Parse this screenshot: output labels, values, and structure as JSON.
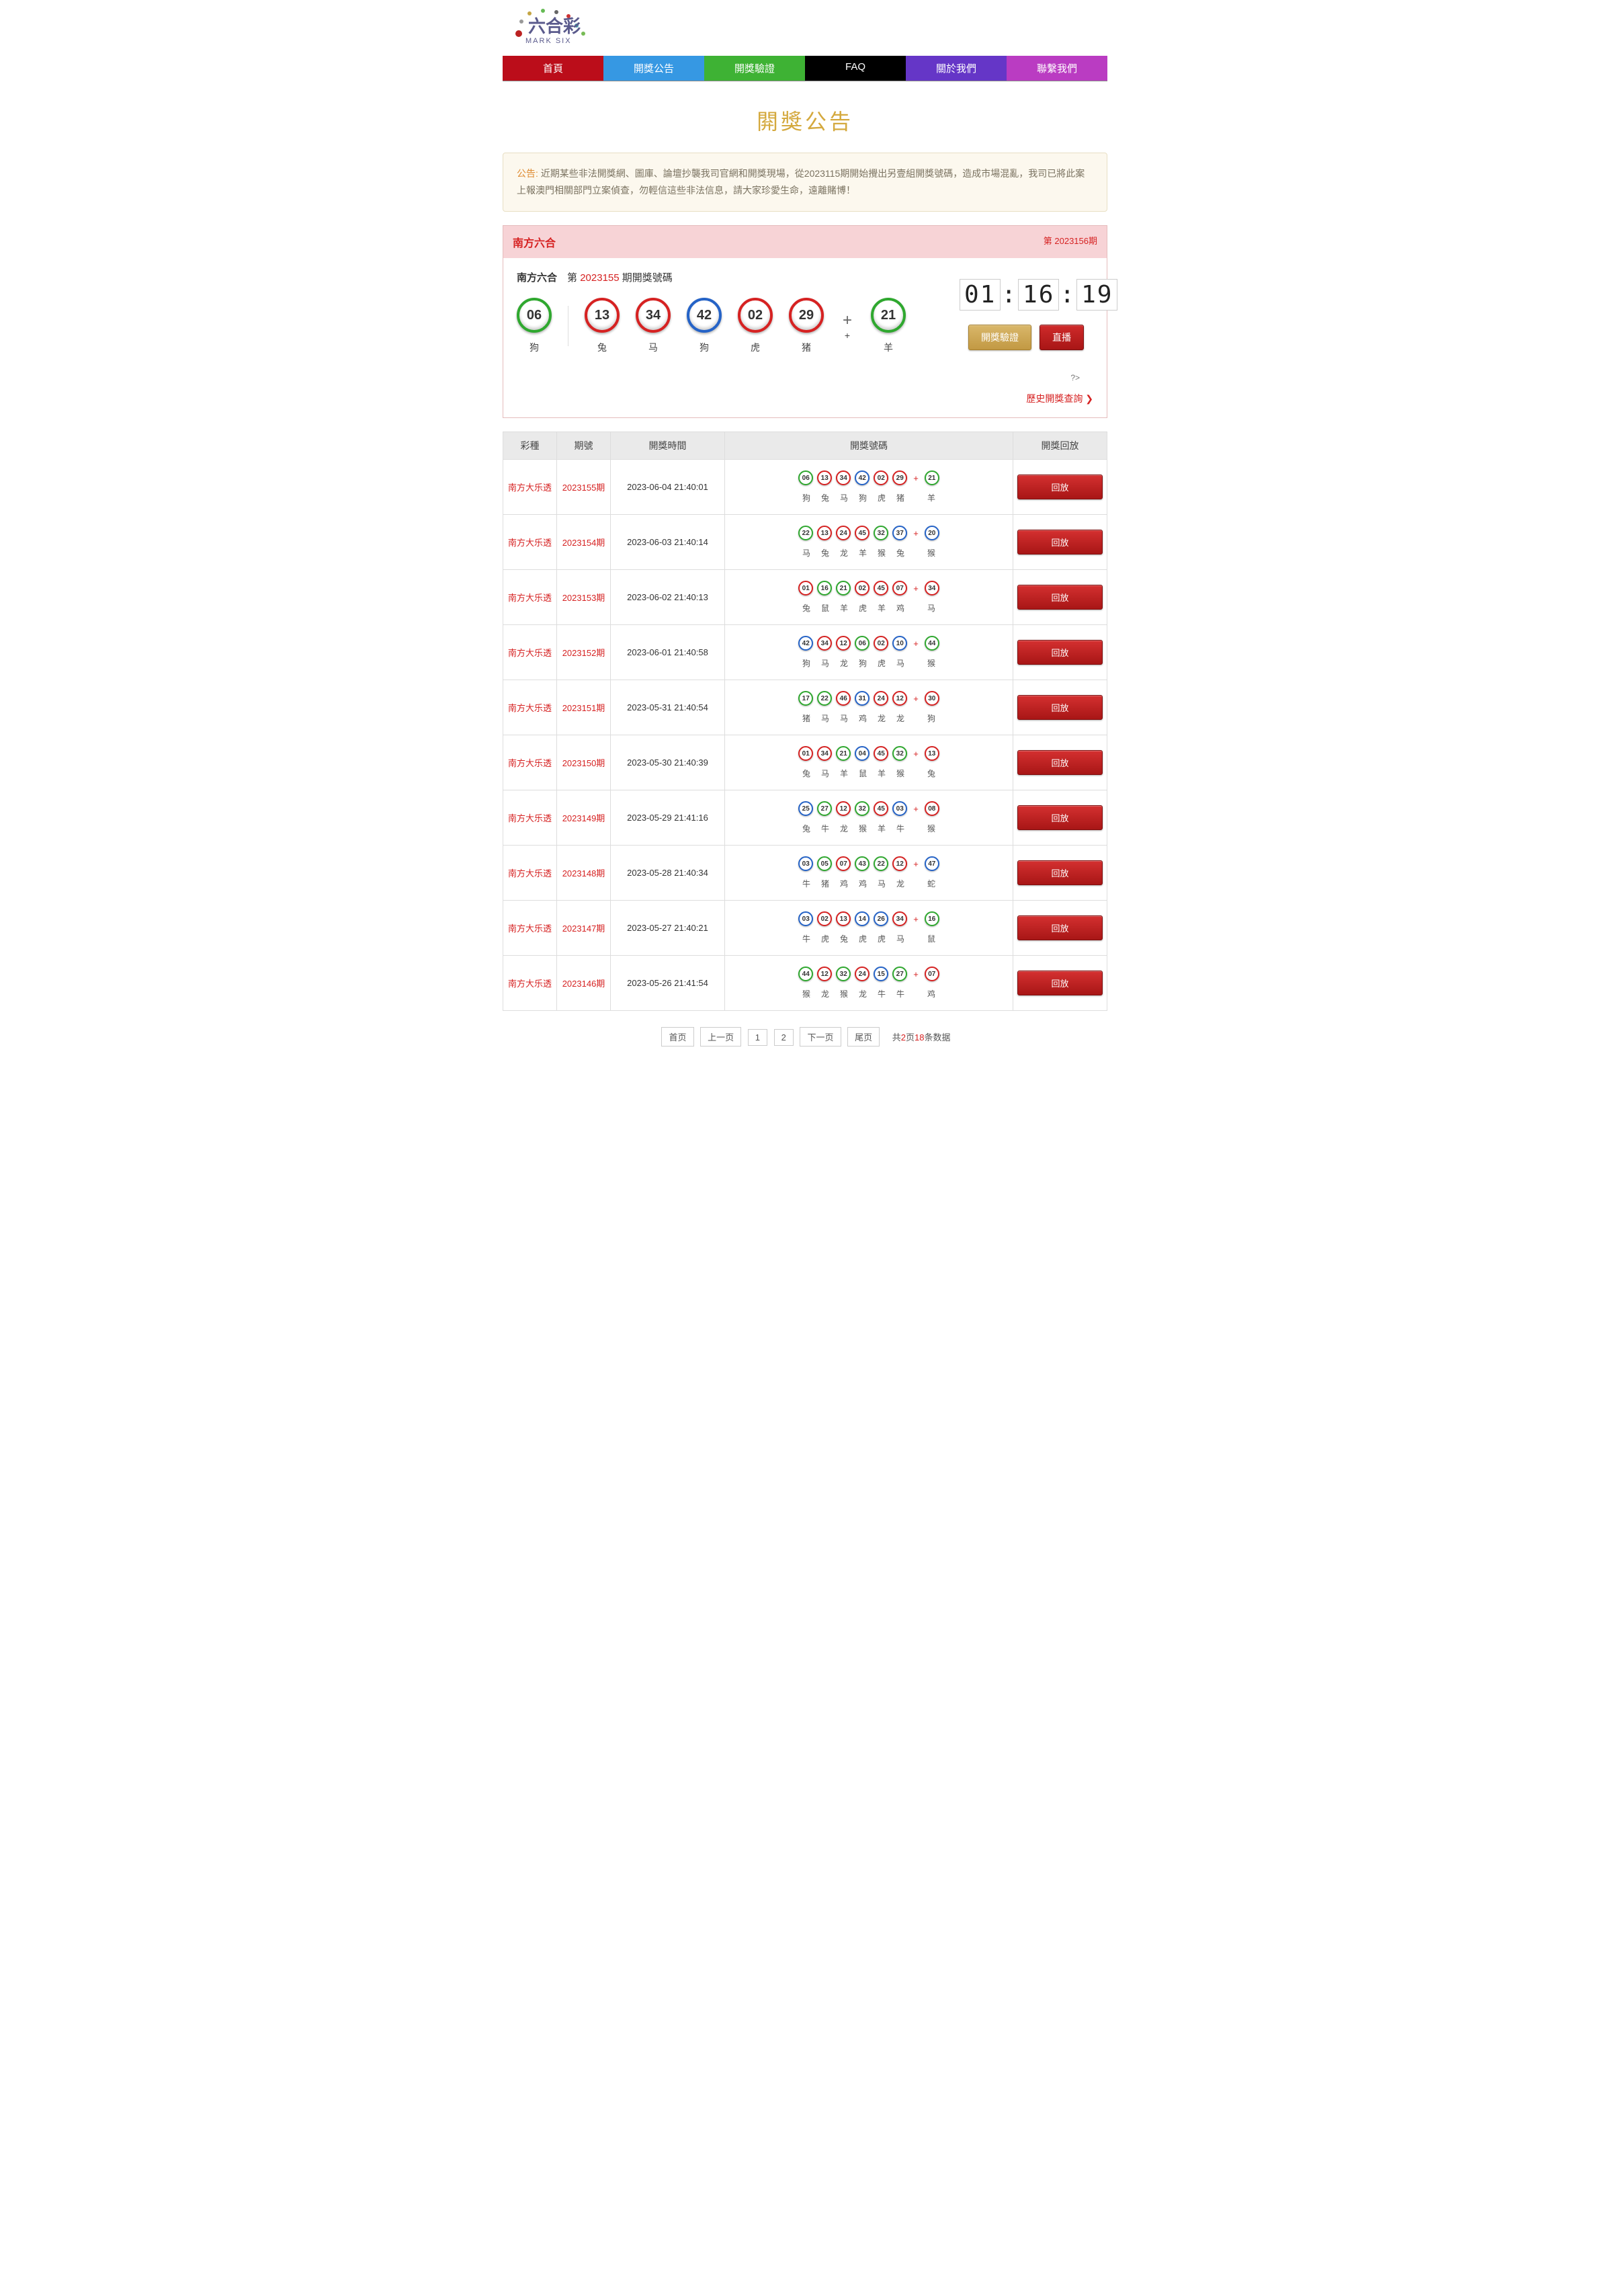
{
  "logo": {
    "line1": "六合彩",
    "line2": "MARK SIX"
  },
  "nav": {
    "home": "首頁",
    "kaijiang": "開獎公告",
    "yanzheng": "開獎驗證",
    "faq": "FAQ",
    "about": "關於我們",
    "contact": "聯繫我們"
  },
  "page_title": "閞獎公告",
  "notice": {
    "label": "公告:",
    "text": "近期某些非法開獎網、圖庫、論壇抄襲我司官網和開獎現場，從2023115期開始攪出另壹組開獎號碼，造成市場混亂，我司已將此案上報澳門相關部門立案偵查，勿輕信這些非法信息，請大家珍愛生命，遠離賭博！"
  },
  "result_header": {
    "left": "南方六合",
    "right": "第 2023156期"
  },
  "result_issue": {
    "prefix": "南方六合",
    "mid": "第",
    "num": "2023155",
    "suffix": "期開獎號碼"
  },
  "main_balls": [
    {
      "n": "06",
      "c": "green",
      "z": "狗"
    },
    {
      "n": "13",
      "c": "red",
      "z": "兔"
    },
    {
      "n": "34",
      "c": "red",
      "z": "马"
    },
    {
      "n": "42",
      "c": "blue",
      "z": "狗"
    },
    {
      "n": "02",
      "c": "red",
      "z": "虎"
    },
    {
      "n": "29",
      "c": "red",
      "z": "猪"
    }
  ],
  "special_ball": {
    "n": "21",
    "c": "green",
    "z": "羊"
  },
  "plus_label": "+",
  "countdown": {
    "h": "01",
    "m": "16",
    "s": "19"
  },
  "buttons": {
    "verify": "開獎驗證",
    "live": "直播"
  },
  "history_link": "歷史開獎查詢",
  "extra_text": "?>",
  "table_headers": {
    "type": "彩種",
    "issue": "期號",
    "time": "開獎時間",
    "numbers": "開獎號碼",
    "replay": "開獎回放"
  },
  "replay_label": "回放",
  "rows": [
    {
      "name": "南方大乐透",
      "issue": "2023155期",
      "time": "2023-06-04 21:40:01",
      "balls": [
        {
          "n": "06",
          "c": "green"
        },
        {
          "n": "13",
          "c": "red"
        },
        {
          "n": "34",
          "c": "red"
        },
        {
          "n": "42",
          "c": "blue"
        },
        {
          "n": "02",
          "c": "red"
        },
        {
          "n": "29",
          "c": "red"
        }
      ],
      "sp": {
        "n": "21",
        "c": "green"
      },
      "z": [
        "狗",
        "兔",
        "马",
        "狗",
        "虎",
        "猪",
        "羊"
      ]
    },
    {
      "name": "南方大乐透",
      "issue": "2023154期",
      "time": "2023-06-03 21:40:14",
      "balls": [
        {
          "n": "22",
          "c": "green"
        },
        {
          "n": "13",
          "c": "red"
        },
        {
          "n": "24",
          "c": "red"
        },
        {
          "n": "45",
          "c": "red"
        },
        {
          "n": "32",
          "c": "green"
        },
        {
          "n": "37",
          "c": "blue"
        }
      ],
      "sp": {
        "n": "20",
        "c": "blue"
      },
      "z": [
        "马",
        "兔",
        "龙",
        "羊",
        "猴",
        "兔",
        "猴"
      ]
    },
    {
      "name": "南方大乐透",
      "issue": "2023153期",
      "time": "2023-06-02 21:40:13",
      "balls": [
        {
          "n": "01",
          "c": "red"
        },
        {
          "n": "16",
          "c": "green"
        },
        {
          "n": "21",
          "c": "green"
        },
        {
          "n": "02",
          "c": "red"
        },
        {
          "n": "45",
          "c": "red"
        },
        {
          "n": "07",
          "c": "red"
        }
      ],
      "sp": {
        "n": "34",
        "c": "red"
      },
      "z": [
        "兔",
        "鼠",
        "羊",
        "虎",
        "羊",
        "鸡",
        "马"
      ]
    },
    {
      "name": "南方大乐透",
      "issue": "2023152期",
      "time": "2023-06-01 21:40:58",
      "balls": [
        {
          "n": "42",
          "c": "blue"
        },
        {
          "n": "34",
          "c": "red"
        },
        {
          "n": "12",
          "c": "red"
        },
        {
          "n": "06",
          "c": "green"
        },
        {
          "n": "02",
          "c": "red"
        },
        {
          "n": "10",
          "c": "blue"
        }
      ],
      "sp": {
        "n": "44",
        "c": "green"
      },
      "z": [
        "狗",
        "马",
        "龙",
        "狗",
        "虎",
        "马",
        "猴"
      ]
    },
    {
      "name": "南方大乐透",
      "issue": "2023151期",
      "time": "2023-05-31 21:40:54",
      "balls": [
        {
          "n": "17",
          "c": "green"
        },
        {
          "n": "22",
          "c": "green"
        },
        {
          "n": "46",
          "c": "red"
        },
        {
          "n": "31",
          "c": "blue"
        },
        {
          "n": "24",
          "c": "red"
        },
        {
          "n": "12",
          "c": "red"
        }
      ],
      "sp": {
        "n": "30",
        "c": "red"
      },
      "z": [
        "猪",
        "马",
        "马",
        "鸡",
        "龙",
        "龙",
        "狗"
      ]
    },
    {
      "name": "南方大乐透",
      "issue": "2023150期",
      "time": "2023-05-30 21:40:39",
      "balls": [
        {
          "n": "01",
          "c": "red"
        },
        {
          "n": "34",
          "c": "red"
        },
        {
          "n": "21",
          "c": "green"
        },
        {
          "n": "04",
          "c": "blue"
        },
        {
          "n": "45",
          "c": "red"
        },
        {
          "n": "32",
          "c": "green"
        }
      ],
      "sp": {
        "n": "13",
        "c": "red"
      },
      "z": [
        "兔",
        "马",
        "羊",
        "鼠",
        "羊",
        "猴",
        "兔"
      ]
    },
    {
      "name": "南方大乐透",
      "issue": "2023149期",
      "time": "2023-05-29 21:41:16",
      "balls": [
        {
          "n": "25",
          "c": "blue"
        },
        {
          "n": "27",
          "c": "green"
        },
        {
          "n": "12",
          "c": "red"
        },
        {
          "n": "32",
          "c": "green"
        },
        {
          "n": "45",
          "c": "red"
        },
        {
          "n": "03",
          "c": "blue"
        }
      ],
      "sp": {
        "n": "08",
        "c": "red"
      },
      "z": [
        "兔",
        "牛",
        "龙",
        "猴",
        "羊",
        "牛",
        "猴"
      ]
    },
    {
      "name": "南方大乐透",
      "issue": "2023148期",
      "time": "2023-05-28 21:40:34",
      "balls": [
        {
          "n": "03",
          "c": "blue"
        },
        {
          "n": "05",
          "c": "green"
        },
        {
          "n": "07",
          "c": "red"
        },
        {
          "n": "43",
          "c": "green"
        },
        {
          "n": "22",
          "c": "green"
        },
        {
          "n": "12",
          "c": "red"
        }
      ],
      "sp": {
        "n": "47",
        "c": "blue"
      },
      "z": [
        "牛",
        "猪",
        "鸡",
        "鸡",
        "马",
        "龙",
        "蛇"
      ]
    },
    {
      "name": "南方大乐透",
      "issue": "2023147期",
      "time": "2023-05-27 21:40:21",
      "balls": [
        {
          "n": "03",
          "c": "blue"
        },
        {
          "n": "02",
          "c": "red"
        },
        {
          "n": "13",
          "c": "red"
        },
        {
          "n": "14",
          "c": "blue"
        },
        {
          "n": "26",
          "c": "blue"
        },
        {
          "n": "34",
          "c": "red"
        }
      ],
      "sp": {
        "n": "16",
        "c": "green"
      },
      "z": [
        "牛",
        "虎",
        "兔",
        "虎",
        "虎",
        "马",
        "鼠"
      ]
    },
    {
      "name": "南方大乐透",
      "issue": "2023146期",
      "time": "2023-05-26 21:41:54",
      "balls": [
        {
          "n": "44",
          "c": "green"
        },
        {
          "n": "12",
          "c": "red"
        },
        {
          "n": "32",
          "c": "green"
        },
        {
          "n": "24",
          "c": "red"
        },
        {
          "n": "15",
          "c": "blue"
        },
        {
          "n": "27",
          "c": "green"
        }
      ],
      "sp": {
        "n": "07",
        "c": "red"
      },
      "z": [
        "猴",
        "龙",
        "猴",
        "龙",
        "牛",
        "牛",
        "鸡"
      ]
    }
  ],
  "pagination": {
    "first": "首页",
    "prev": "上一页",
    "p1": "1",
    "p2": "2",
    "next": "下一页",
    "last": "尾页",
    "info_prefix": "共",
    "pages": "2",
    "info_mid": "页",
    "records": "18",
    "info_suffix": "条数据"
  }
}
